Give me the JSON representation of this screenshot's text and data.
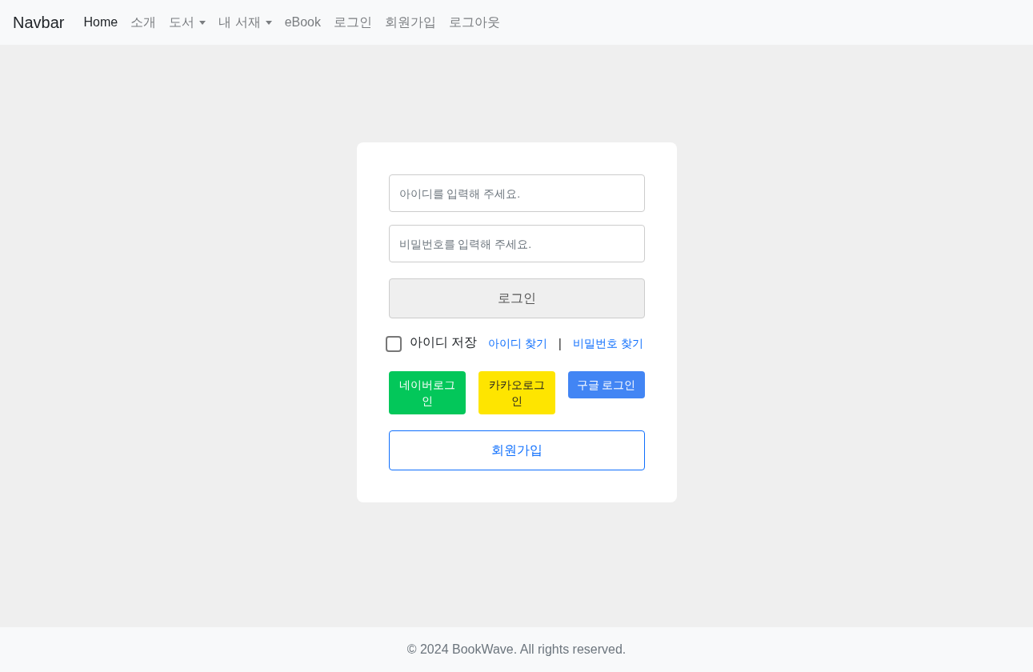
{
  "navbar": {
    "brand": "Navbar",
    "items": [
      {
        "label": "Home",
        "selected": true,
        "dropdown": false
      },
      {
        "label": "소개",
        "selected": false,
        "dropdown": false
      },
      {
        "label": "도서",
        "selected": false,
        "dropdown": true
      },
      {
        "label": "내 서재",
        "selected": false,
        "dropdown": true
      },
      {
        "label": "eBook",
        "selected": false,
        "dropdown": false
      },
      {
        "label": "로그인",
        "selected": false,
        "dropdown": false
      },
      {
        "label": "회원가입",
        "selected": false,
        "dropdown": false
      },
      {
        "label": "로그아웃",
        "selected": false,
        "dropdown": false
      }
    ]
  },
  "login": {
    "id_field": {
      "placeholder": "아이디를 입력해 주세요."
    },
    "password_field": {
      "placeholder": "비밀번호를 입력해 주세요."
    },
    "login_button": "로그인",
    "remember": {
      "label": "아이디 저장",
      "checked": false
    },
    "links": [
      "아이디 찾기",
      "비밀번호 찾기"
    ],
    "separator": "|",
    "social_buttons": [
      {
        "kind": "naver",
        "label": "네이버로그인"
      },
      {
        "kind": "kakao",
        "label": "카카오로그인"
      },
      {
        "kind": "google",
        "label": "구글 로그인"
      }
    ],
    "signup_button": "회원가입"
  },
  "footer": "© 2024 BookWave. All rights reserved."
}
